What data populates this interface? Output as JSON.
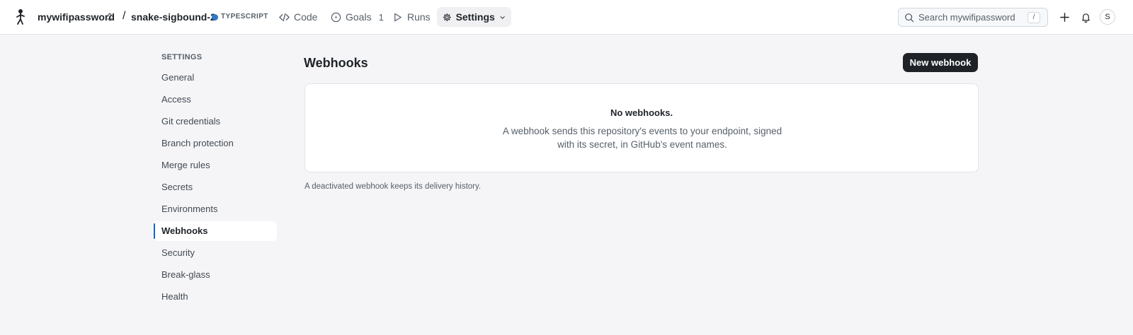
{
  "header": {
    "org": "mywifipassword",
    "repo": "snake-sigbound-2",
    "language": "TYPESCRIPT",
    "language_color": "#3178c6",
    "nav": [
      {
        "label": "Code",
        "icon": "code-icon"
      },
      {
        "label": "Goals",
        "icon": "goal-icon",
        "badge": "1"
      },
      {
        "label": "Runs",
        "icon": "play-icon"
      },
      {
        "label": "Settings",
        "icon": "gear-icon",
        "active": true
      }
    ],
    "search_placeholder": "Search mywifipassword",
    "search_shortcut": "/",
    "avatar_initial": "S"
  },
  "sidebar": {
    "title": "SETTINGS",
    "items": [
      {
        "label": "General"
      },
      {
        "label": "Access"
      },
      {
        "label": "Git credentials"
      },
      {
        "label": "Branch protection"
      },
      {
        "label": "Merge rules"
      },
      {
        "label": "Secrets"
      },
      {
        "label": "Environments"
      },
      {
        "label": "Webhooks",
        "active": true
      },
      {
        "label": "Security"
      },
      {
        "label": "Break-glass"
      },
      {
        "label": "Health"
      }
    ]
  },
  "main": {
    "title": "Webhooks",
    "new_button": "New webhook",
    "empty_title": "No webhooks.",
    "empty_desc": "A webhook sends this repository's events to your endpoint, signed with its secret, in GitHub's event names.",
    "footnote": "A deactivated webhook keeps its delivery history."
  },
  "colors": {
    "accent": "#0969da",
    "primary_button": "#1f2328"
  }
}
